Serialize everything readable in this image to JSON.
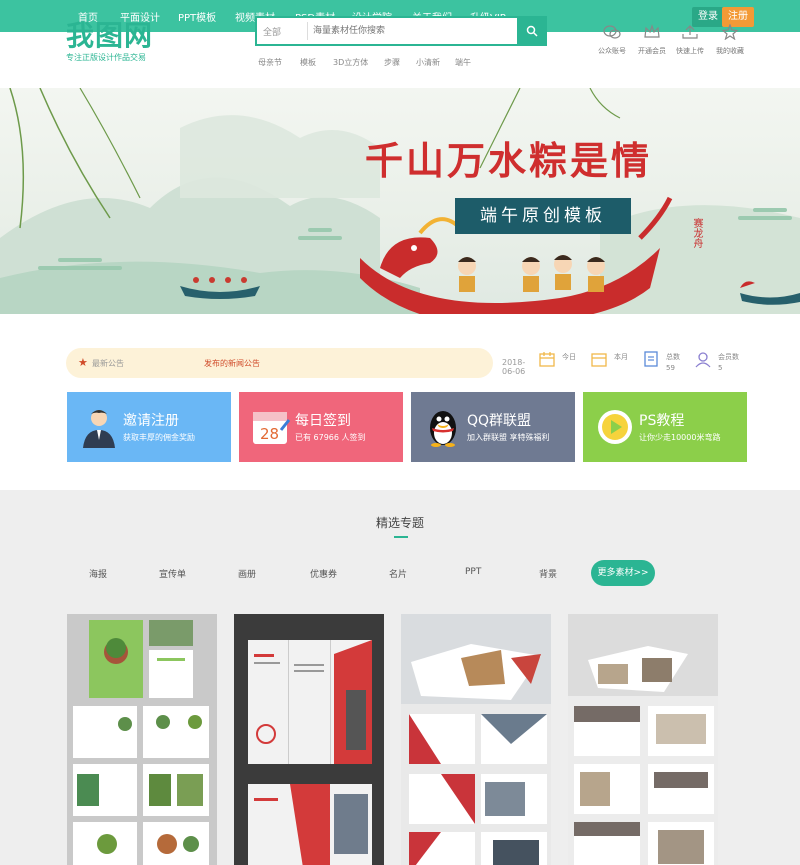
{
  "topnav": {
    "items": [
      "首页",
      "平面设计",
      "PPT模板",
      "视频素材",
      "PSD素材",
      "设计学院",
      "关于我们",
      "升级VIP"
    ],
    "login": "登录",
    "register": "注册"
  },
  "header": {
    "logo": "我图网",
    "slogan": "专注正版设计作品交易",
    "search_category": "全部",
    "search_placeholder": "海量素材任你搜索",
    "hotwords": [
      "母亲节",
      "模板",
      "3D立方体",
      "步骤",
      "小清新",
      "端午"
    ],
    "icons": [
      {
        "name": "wechat-icon",
        "label": "公众账号"
      },
      {
        "name": "vip-icon",
        "label": "开通会员"
      },
      {
        "name": "upload-icon",
        "label": "快速上传"
      },
      {
        "name": "favorite-icon",
        "label": "我的收藏"
      }
    ]
  },
  "banner": {
    "title": "千山万水粽是情",
    "subtitle": "端午原创模板",
    "seal": "赛龙舟"
  },
  "notice": {
    "label": "最新公告",
    "link": "发布的新闻公告",
    "date": "2018-06-06"
  },
  "stats": [
    {
      "label": "今日",
      "value": ""
    },
    {
      "label": "本月",
      "value": ""
    },
    {
      "label": "总数",
      "value": "59"
    },
    {
      "label": "会员数",
      "value": "5"
    }
  ],
  "cards": [
    {
      "title": "邀请注册",
      "desc": "获取丰厚的佣金奖励",
      "color": "#6ab7f5"
    },
    {
      "title": "每日签到",
      "desc": "已有 67966 人签到",
      "color": "#f0667b"
    },
    {
      "title": "QQ群联盟",
      "desc": "加入群联盟 享特殊福利",
      "color": "#6f7a92"
    },
    {
      "title": "PS教程",
      "desc": "让你少走10000米弯路",
      "color": "#8ccf4a"
    }
  ],
  "section": {
    "title": "精选专题",
    "tabs": [
      "海报",
      "宣传单",
      "画册",
      "优惠券",
      "名片",
      "PPT",
      "背景"
    ],
    "more": "更多素材>>"
  },
  "colors": {
    "brand": "#2bb593",
    "nav": "#3cc3a0",
    "accent_red": "#cf2e2e",
    "orange": "#f39a36"
  }
}
